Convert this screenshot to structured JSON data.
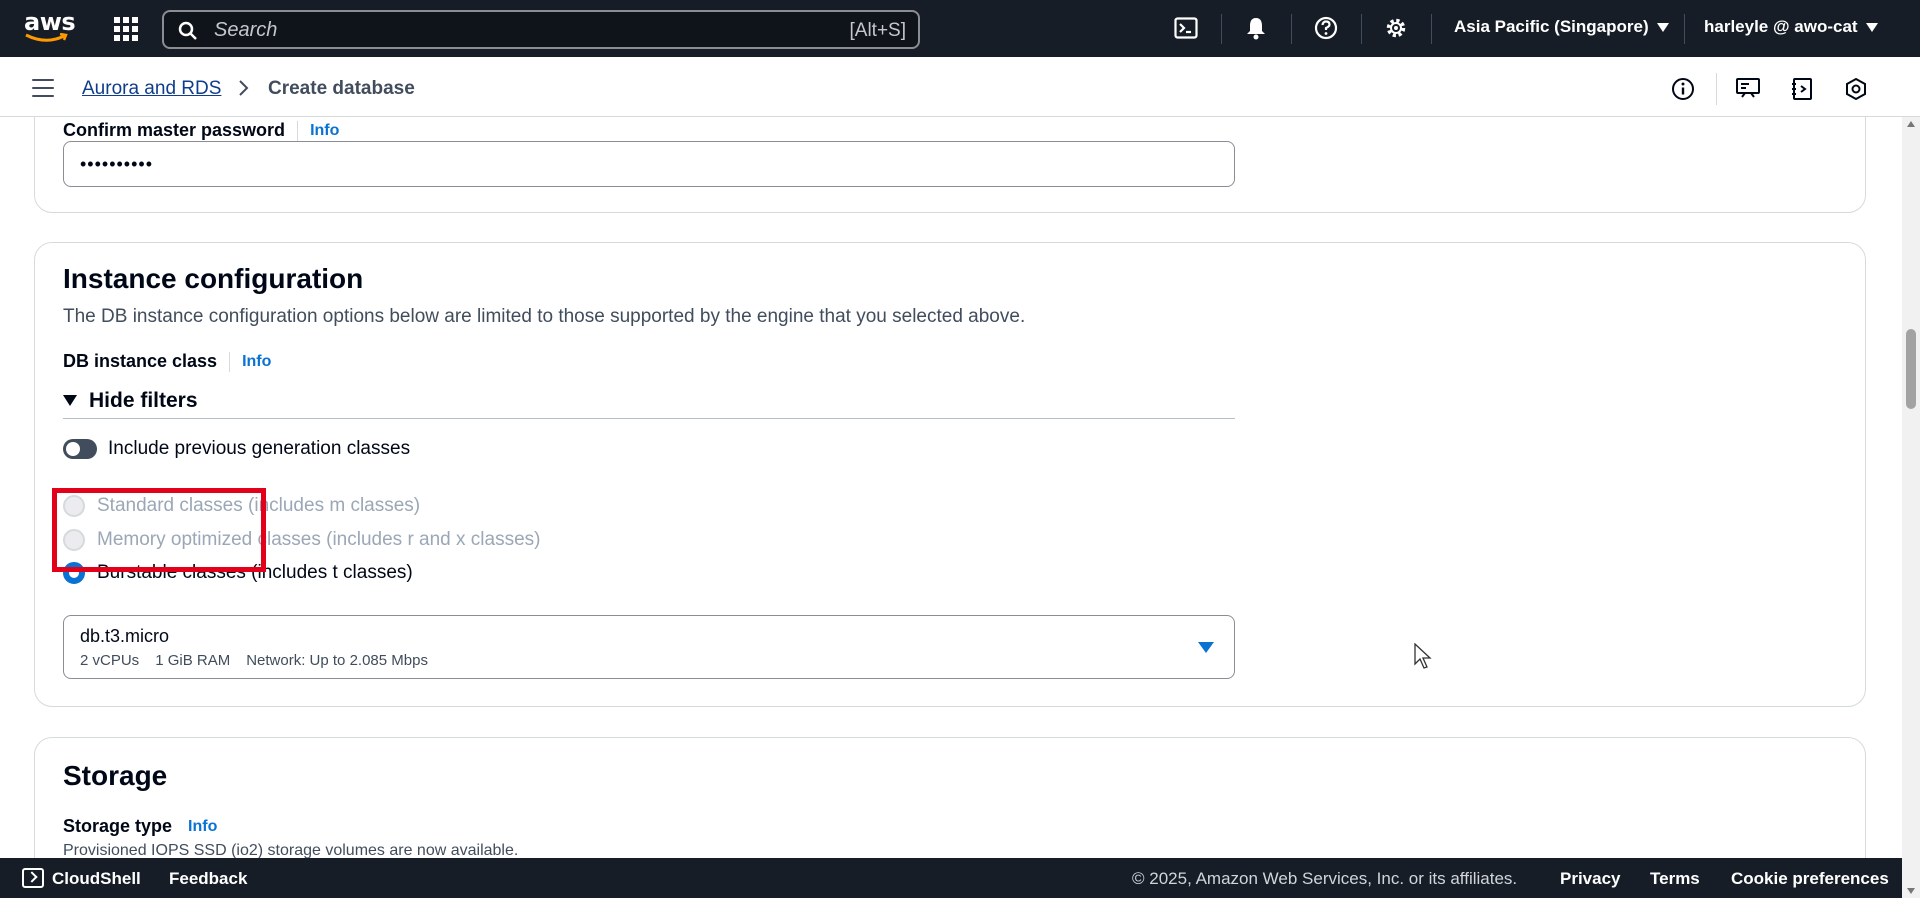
{
  "topnav": {
    "logo_text": "aws",
    "search_placeholder": "Search",
    "search_shortcut": "[Alt+S]",
    "region": "Asia Pacific (Singapore)",
    "account": "harleyle @ awo-cat",
    "icons": [
      "cloudshell-icon",
      "bell-icon",
      "help-icon",
      "gear-icon"
    ]
  },
  "breadcrumb": {
    "service": "Aurora and RDS",
    "current": "Create database"
  },
  "credentials": {
    "confirm_label": "Confirm master password",
    "info": "Info",
    "confirm_value": "••••••••••"
  },
  "instance": {
    "title": "Instance configuration",
    "description": "The DB instance configuration options below are limited to those supported by the engine that you selected above.",
    "class_label": "DB instance class",
    "info": "Info",
    "filters_label": "Hide filters",
    "toggle_label": "Include previous generation classes",
    "radios": [
      {
        "label": "Standard classes (includes m classes)",
        "selected": false
      },
      {
        "label": "Memory optimized classes (includes r and x classes)",
        "selected": false
      },
      {
        "label": "Burstable classes (includes t classes)",
        "selected": true
      }
    ],
    "selected_class": "db.t3.micro",
    "specs": [
      "2 vCPUs",
      "1 GiB RAM",
      "Network: Up to 2.085 Mbps"
    ]
  },
  "storage": {
    "title": "Storage",
    "type_label": "Storage type",
    "info": "Info",
    "note": "Provisioned IOPS SSD (io2) storage volumes are now available."
  },
  "footer": {
    "cloudshell": "CloudShell",
    "feedback": "Feedback",
    "copyright": "© 2025, Amazon Web Services, Inc. or its affiliates.",
    "privacy": "Privacy",
    "terms": "Terms",
    "cookies": "Cookie preferences"
  }
}
